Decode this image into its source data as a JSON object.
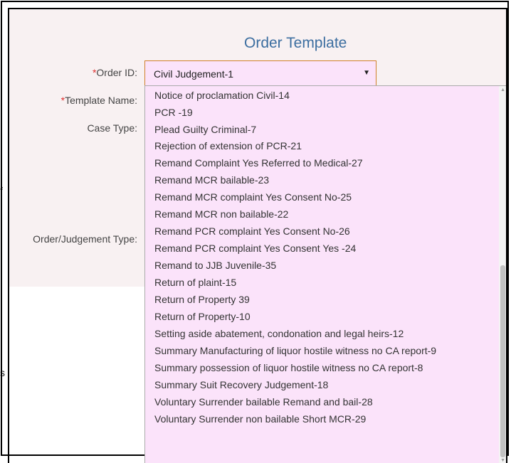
{
  "page": {
    "title": "Order Template",
    "left_fragments": [
      "f",
      "s"
    ]
  },
  "form": {
    "order_id_label": "Order ID:",
    "template_name_label": "Template Name:",
    "case_type_label": "Case Type:",
    "order_judgement_type_label": "Order/Judgement Type:",
    "required_mark": "*",
    "order_id_value": "Civil Judgement-1",
    "select_arrow": "▼"
  },
  "dropdown": {
    "options": [
      "Notice of proclamation Civil-14",
      "PCR -19",
      "Plead Guilty Criminal-7",
      "Rejection of extension of PCR-21",
      "Remand Complaint Yes Referred to Medical-27",
      "Remand MCR bailable-23",
      "Remand MCR complaint Yes Consent No-25",
      "Remand MCR non bailable-22",
      "Remand PCR complaint Yes Consent No-26",
      "Remand PCR complaint Yes Consent Yes -24",
      "Remand to JJB Juvenile-35",
      "Return of plaint-15",
      "Return of Property 39",
      "Return of Property-10",
      "Setting aside abatement, condonation and legal heirs-12",
      "Summary Manufacturing of liquor hostile witness no CA report-9",
      "Summary possession of liquor hostile witness no CA report-8",
      "Summary Suit Recovery Judgement-18",
      "Voluntary Surrender bailable Remand and bail-28",
      "Voluntary Surrender non bailable Short MCR-29"
    ]
  },
  "colors": {
    "title": "#3c6ea0",
    "panel_bg": "#f8f1f2",
    "select_bg": "#fbe3fa",
    "select_border": "#d0802a",
    "required": "#e03030"
  }
}
